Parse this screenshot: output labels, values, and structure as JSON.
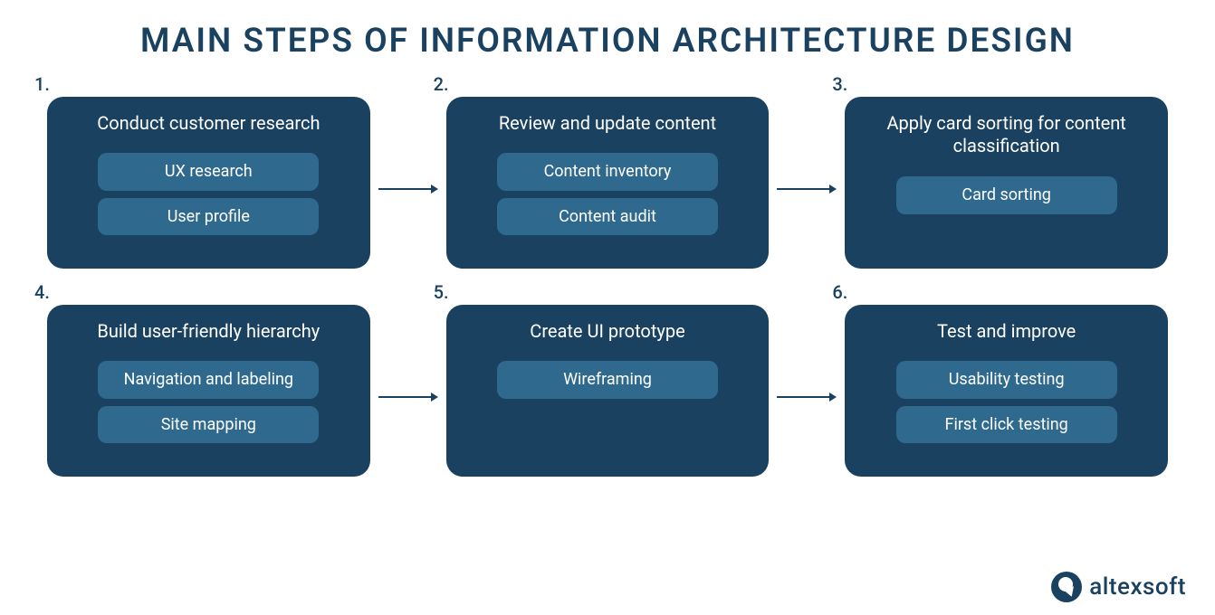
{
  "title": "MAIN STEPS OF INFORMATION ARCHITECTURE DESIGN",
  "steps": [
    {
      "num": "1.",
      "title": "Conduct customer research",
      "subs": [
        "UX research",
        "User profile"
      ]
    },
    {
      "num": "2.",
      "title": "Review and update content",
      "subs": [
        "Content inventory",
        "Content audit"
      ]
    },
    {
      "num": "3.",
      "title": "Apply card sorting for content classification",
      "subs": [
        "Card sorting"
      ]
    },
    {
      "num": "4.",
      "title": "Build user-friendly hierarchy",
      "subs": [
        "Navigation and labeling",
        "Site mapping"
      ]
    },
    {
      "num": "5.",
      "title": "Create UI prototype",
      "subs": [
        "Wireframing"
      ]
    },
    {
      "num": "6.",
      "title": "Test and improve",
      "subs": [
        "Usability testing",
        "First click testing"
      ]
    }
  ],
  "brand": {
    "name": "altexsoft"
  },
  "colors": {
    "card": "#1a4260",
    "pill": "#2f6a8e",
    "arrow": "#1a4260"
  }
}
